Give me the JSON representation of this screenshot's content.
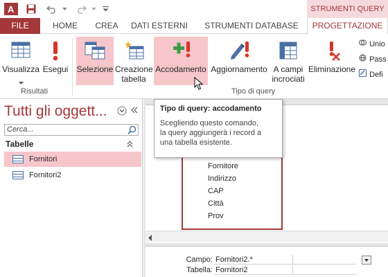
{
  "app": {
    "name": "Access",
    "logo_text": "A"
  },
  "quick_access": [
    "save-icon",
    "undo-icon",
    "redo-icon",
    "customize-icon"
  ],
  "context_header": "STRUMENTI QUERY",
  "tabs": {
    "file": "FILE",
    "home": "HOME",
    "create": "CREA",
    "external": "DATI ESTERNI",
    "database": "STRUMENTI DATABASE",
    "design": "PROGETTAZIONE"
  },
  "ribbon": {
    "view": "Visualizza",
    "run": "Esegui",
    "results_group": "Risultati",
    "select": "Selezione",
    "make_table_1": "Creazione",
    "make_table_2": "tabella",
    "append": "Accodamento",
    "update": "Aggiornamento",
    "crosstab_1": "A campi",
    "crosstab_2": "incrociati",
    "delete": "Eliminazione",
    "query_type_group": "Tipo di query",
    "union": "Unio",
    "passthrough": "Pass",
    "definition": "Defi"
  },
  "nav": {
    "title": "Tutti gli oggett...",
    "search_placeholder": "Cerca...",
    "section": "Tabelle",
    "items": [
      {
        "label": "Fornitori",
        "selected": true
      },
      {
        "label": "Fornitori2",
        "selected": false
      }
    ]
  },
  "field_list": [
    "Fornitore",
    "Indirizzo",
    "CAP",
    "Città",
    "Prov"
  ],
  "grid": {
    "field_label": "Campo:",
    "table_label": "Tabella:",
    "field_value": "Fornitori2.*",
    "table_value": "Fornitori2"
  },
  "tooltip": {
    "title": "Tipo di query: accodamento",
    "line1": "Scegliendo questo comando,",
    "line2": "la query aggiungerà i record a",
    "line3": "una tabella esistente."
  },
  "colors": {
    "accent": "#a4373a",
    "highlight": "#f6c6cb",
    "context": "#f6d9dd"
  }
}
